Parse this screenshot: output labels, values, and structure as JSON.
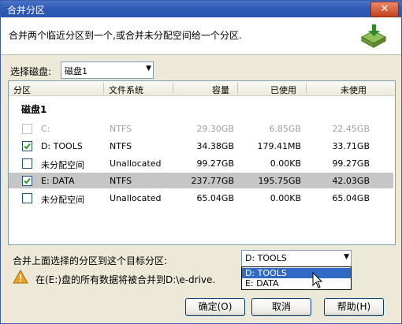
{
  "window": {
    "title": "合并分区",
    "close_glyph": "✕"
  },
  "header": {
    "description": "合并两个临近分区到一个,或合并未分配空间给一个分区.",
    "icon": "merge-partition-icon"
  },
  "disk_selector": {
    "label": "选择磁盘:",
    "value": "磁盘1"
  },
  "table": {
    "headers": {
      "partition": "分区",
      "filesystem": "文件系统",
      "capacity": "容量",
      "used": "已使用",
      "unused": "未使用"
    },
    "group": "磁盘1",
    "rows": [
      {
        "name": "C:",
        "fs": "NTFS",
        "capacity": "29.30GB",
        "used": "6.85GB",
        "free": "22.45GB",
        "checked": false,
        "enabled": false,
        "selected": false
      },
      {
        "name": "D:  TOOLS",
        "fs": "NTFS",
        "capacity": "34.38GB",
        "used": "179.41MB",
        "free": "33.71GB",
        "checked": true,
        "enabled": true,
        "selected": false
      },
      {
        "name": "未分配空间",
        "fs": "Unallocated",
        "capacity": "99.27GB",
        "used": "0.00KB",
        "free": "99.27GB",
        "checked": false,
        "enabled": true,
        "selected": false
      },
      {
        "name": "E:  DATA",
        "fs": "NTFS",
        "capacity": "237.77GB",
        "used": "195.75GB",
        "free": "42.03GB",
        "checked": true,
        "enabled": true,
        "selected": true
      },
      {
        "name": "未分配空间",
        "fs": "Unallocated",
        "capacity": "65.04GB",
        "used": "0.00KB",
        "free": "65.04GB",
        "checked": false,
        "enabled": true,
        "selected": false
      }
    ]
  },
  "target": {
    "label": "合并上面选择的分区到这个目标分区:",
    "value": "D:  TOOLS",
    "options": [
      "D:  TOOLS",
      "E:  DATA"
    ],
    "highlighted_index": 0
  },
  "warning": {
    "text": "在(E:)盘的所有数据将被合并到D:\\e-drive."
  },
  "buttons": {
    "ok": "确定(O)",
    "cancel": "取消",
    "help": "帮助(H)"
  },
  "colors": {
    "title_bar": "#2f5bb6",
    "highlight": "#316ac5",
    "selected_row": "#c6c6c6"
  }
}
